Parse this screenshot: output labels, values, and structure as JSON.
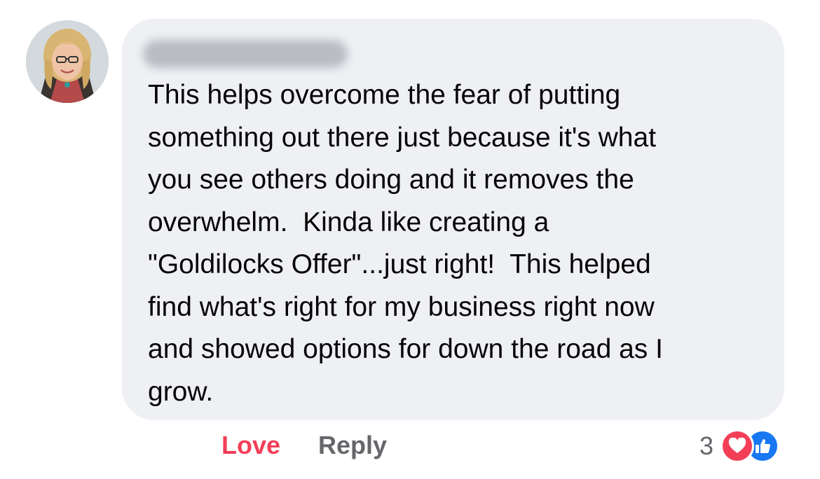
{
  "comment": {
    "text": "This helps overcome the fear of putting\nsomething out there just because it's what\nyou see others doing and it removes the\noverwhelm.  Kinda like creating a\n\"Goldilocks Offer\"...just right!  This helped\nfind what's right for my business right now\nand showed options for down the road as I\ngrow."
  },
  "actions": {
    "love_label": "Love",
    "reply_label": "Reply"
  },
  "reactions": {
    "count": "3",
    "types": [
      "love-icon",
      "like-icon"
    ]
  },
  "colors": {
    "bubble": "#eff0f4",
    "love": "#f33e58",
    "like": "#1877f2",
    "secondary_text": "#65676b"
  }
}
